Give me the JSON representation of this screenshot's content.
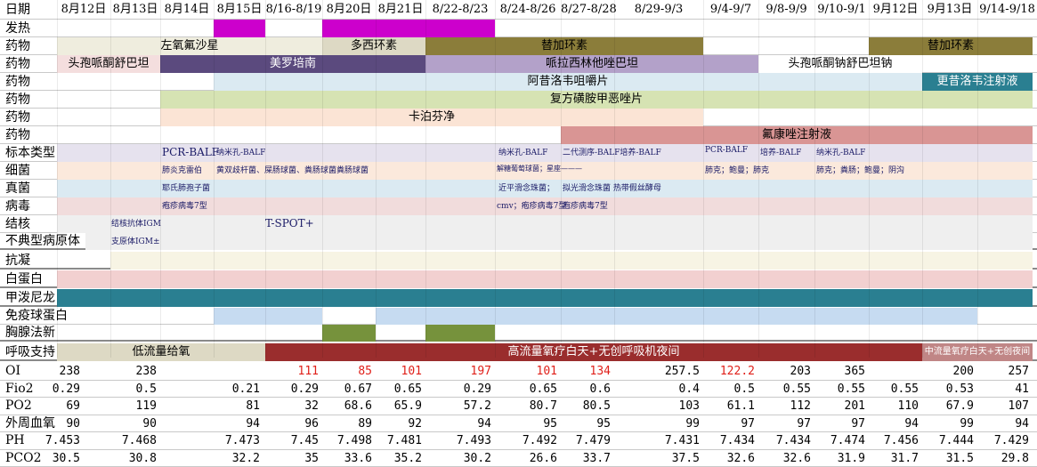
{
  "dates": [
    "8月12日",
    "8月13日",
    "8月14日",
    "8月15日",
    "8/16-8/19",
    "8月20日",
    "8月21日",
    "8/22-8/23",
    "8/24-8/26",
    "8/27-8/28",
    "8/29-9/3",
    "9/4-9/7",
    "9/8-9/9",
    "9/10-9/1",
    "9月12日",
    "9月13日",
    "9/14-9/18"
  ],
  "header_label": "日期",
  "row_labels": {
    "fever": "发热",
    "drug1": "药物",
    "drug2": "药物",
    "drug3": "药物",
    "drug4": "药物",
    "drug5": "药物",
    "drug6": "药物",
    "specimen": "标本类型",
    "bacteria": "细菌",
    "fungi": "真菌",
    "virus": "病毒",
    "tb": "结核",
    "atypical": "不典型病原体",
    "anticoag": "抗凝",
    "albumin": "白蛋白",
    "mp": "甲泼尼龙",
    "ig": "免疫球蛋白",
    "thymosin": "胸腺法新",
    "resp": "呼吸支持"
  },
  "colors": {
    "fever": "#cc00cc",
    "olive": "#8b7d3a",
    "beige": "#efedde",
    "purple": "#5b4a7e",
    "lavender": "#b3a1c9",
    "lightblue": "#dbeaf2",
    "teal": "#2a7f91",
    "lightgreen": "#d6e3b3",
    "peach": "#fbe4d5",
    "rose": "#d99594",
    "tan": "#ddd9c4",
    "deepred": "#9a2d2d",
    "pink": "#f2d0d0",
    "green": "#76923c",
    "iceblue": "#c6dbf1",
    "gray": "#efefef",
    "pinklight": "#f4dede"
  },
  "drugs": {
    "r1": [
      {
        "text": "左氧氟沙星"
      },
      {
        "text": "多西环素"
      },
      {
        "text": "替加环素"
      },
      {
        "text": "替加环素"
      }
    ],
    "r2": [
      {
        "text": "头孢哌酮舒巴坦"
      },
      {
        "text": "美罗培南"
      },
      {
        "text": "哌拉西林他唑巴坦"
      },
      {
        "text": "头孢哌酮钠舒巴坦钠"
      }
    ],
    "r3": [
      {
        "text": "阿昔洛韦咀嚼片"
      },
      {
        "text": "更昔洛韦注射液"
      }
    ],
    "r4": [
      {
        "text": "复方磺胺甲恶唑片"
      }
    ],
    "r5": [
      {
        "text": "卡泊芬净"
      }
    ],
    "r6": [
      {
        "text": "氟康唑注射液"
      }
    ]
  },
  "micro": {
    "specimen": [
      "PCR-BALF",
      "纳米孔-BALF",
      "纳米孔-BALF",
      "二代测序-BALF培养-BALF",
      "PCR-BALF",
      "培养-BALF",
      "纳米孔-BALF"
    ],
    "bacteria": [
      "肺炎克雷伯",
      "黄双歧杆菌、屎肠球菌、粪肠球菌粪肠球菌",
      "解糖葡萄球菌；星座———",
      "肺克；鲍曼；肺克",
      "肺克；粪肠；鲍曼；阴沟"
    ],
    "fungi": [
      "耶氏肺孢子菌",
      "近平滑念珠菌；",
      "拟光滑念珠菌 热带假丝酵母"
    ],
    "virus": [
      "疱疹病毒7型",
      "cmv；疱疹病毒7型",
      "疱疹病毒7型"
    ],
    "tb": [
      "结核抗体IGM",
      "T-SPOT+"
    ],
    "atypical": [
      "支原体IGM±"
    ]
  },
  "resp": {
    "low": "低流量给氧",
    "high": "高流量氧疗白天+无创呼吸机夜间",
    "mid": "中流量氧疗白天+无创夜间"
  },
  "labs": {
    "labels": [
      "OI",
      "Fio2",
      "PO2",
      "外周血氧",
      "PH",
      "PCO2"
    ],
    "OI": [
      "238",
      "238",
      "",
      "111",
      "85",
      "101",
      "197",
      "101",
      "134",
      "257.5",
      "122.2",
      "203",
      "365",
      "",
      "200",
      "257"
    ],
    "OI_red": [
      false,
      false,
      false,
      true,
      true,
      true,
      true,
      true,
      true,
      false,
      true,
      false,
      false,
      false,
      false,
      false
    ],
    "Fio2": [
      "0.29",
      "0.5",
      "0.21",
      "0.29",
      "0.67",
      "0.65",
      "0.29",
      "0.65",
      "0.6",
      "0.4",
      "0.5",
      "0.55",
      "0.55",
      "0.55",
      "0.53",
      "41"
    ],
    "PO2": [
      "69",
      "119",
      "81",
      "32",
      "68.6",
      "65.9",
      "57.2",
      "80.7",
      "80.5",
      "103",
      "61.1",
      "112",
      "201",
      "110",
      "67.9",
      "107"
    ],
    "SpO2": [
      "90",
      "90",
      "94",
      "96",
      "89",
      "92",
      "94",
      "95",
      "95",
      "99",
      "97",
      "97",
      "97",
      "94",
      "99",
      "94"
    ],
    "PH": [
      "7.453",
      "7.468",
      "7.473",
      "7.45",
      "7.498",
      "7.481",
      "7.493",
      "7.492",
      "7.479",
      "7.431",
      "7.434",
      "7.434",
      "7.474",
      "7.456",
      "7.444",
      "7.429"
    ],
    "PCO2": [
      "30.5",
      "30.8",
      "32.2",
      "35",
      "33.6",
      "35.2",
      "30.2",
      "26.6",
      "33.7",
      "37.5",
      "32.6",
      "32.6",
      "31.9",
      "31.7",
      "31.5",
      "29.8"
    ]
  }
}
